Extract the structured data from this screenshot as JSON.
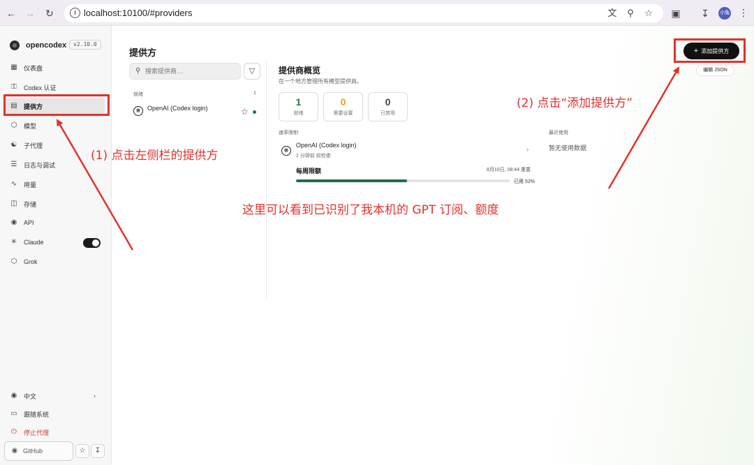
{
  "browser": {
    "url": "localhost:10100/#providers",
    "avatar_text": "小兔",
    "icons": [
      "back-icon",
      "forward-icon",
      "reload-icon",
      "info-icon",
      "translate-icon",
      "zoom-icon",
      "star-icon",
      "extensions-icon",
      "download-icon",
      "menu-icon"
    ]
  },
  "sidebar": {
    "brand": "opencodex",
    "version": "v2.10.0",
    "items": [
      {
        "label": "仪表盘",
        "icon": "dashboard-icon"
      },
      {
        "label": "Codex 认证",
        "icon": "key-icon"
      },
      {
        "label": "提供方",
        "icon": "providers-icon"
      },
      {
        "label": "模型",
        "icon": "cube-icon"
      },
      {
        "label": "子代理",
        "icon": "subagent-icon"
      },
      {
        "label": "日志与调试",
        "icon": "list-icon"
      },
      {
        "label": "用量",
        "icon": "activity-icon"
      },
      {
        "label": "存储",
        "icon": "storage-icon"
      },
      {
        "label": "API",
        "icon": "globe-icon"
      },
      {
        "label": "Claude",
        "icon": "sparkle-icon"
      },
      {
        "label": "Grok",
        "icon": "cube-icon"
      }
    ],
    "active_index": 2,
    "claude_toggle_on": true,
    "footer": {
      "language": "中文",
      "theme": "跟随系统",
      "stop_proxy": "停止代理",
      "github": "GitHub"
    }
  },
  "main": {
    "title": "提供方",
    "search_placeholder": "搜索提供商…",
    "group_label": "就绪",
    "group_count": "1",
    "providers": [
      {
        "name": "OpenAI (Codex login)",
        "status_color": "#1e7a44"
      }
    ],
    "overview": {
      "title": "提供商概览",
      "subtitle": "在一个地方管理所有模型提供商。",
      "stats": [
        {
          "value": "1",
          "label": "就绪",
          "color": "#1e7a44"
        },
        {
          "value": "0",
          "label": "需要设置",
          "color": "#e0a21a"
        },
        {
          "value": "0",
          "label": "已禁用",
          "color": "#444444"
        }
      ],
      "rate_limit_label": "速率限制",
      "recent_label": "最近使用",
      "recent_empty": "暂无使用数据",
      "rate_limit": {
        "provider": "OpenAI (Codex login)",
        "checked": "2 分钟前 前检查",
        "weekly_label": "每周限额",
        "reset": "8月10日, 08:44 重置",
        "used_text": "已用 52%",
        "used_fraction": 0.52
      }
    },
    "add_button": "添加提供方",
    "edit_json": "编辑 JSON"
  },
  "annotations": {
    "step1": "(1)  点击左侧栏的提供方",
    "step2": "(2)  点击“添加提供方”",
    "note": "这里可以看到已识别了我本机的 GPT 订阅、额度",
    "color": "#e4312b"
  }
}
